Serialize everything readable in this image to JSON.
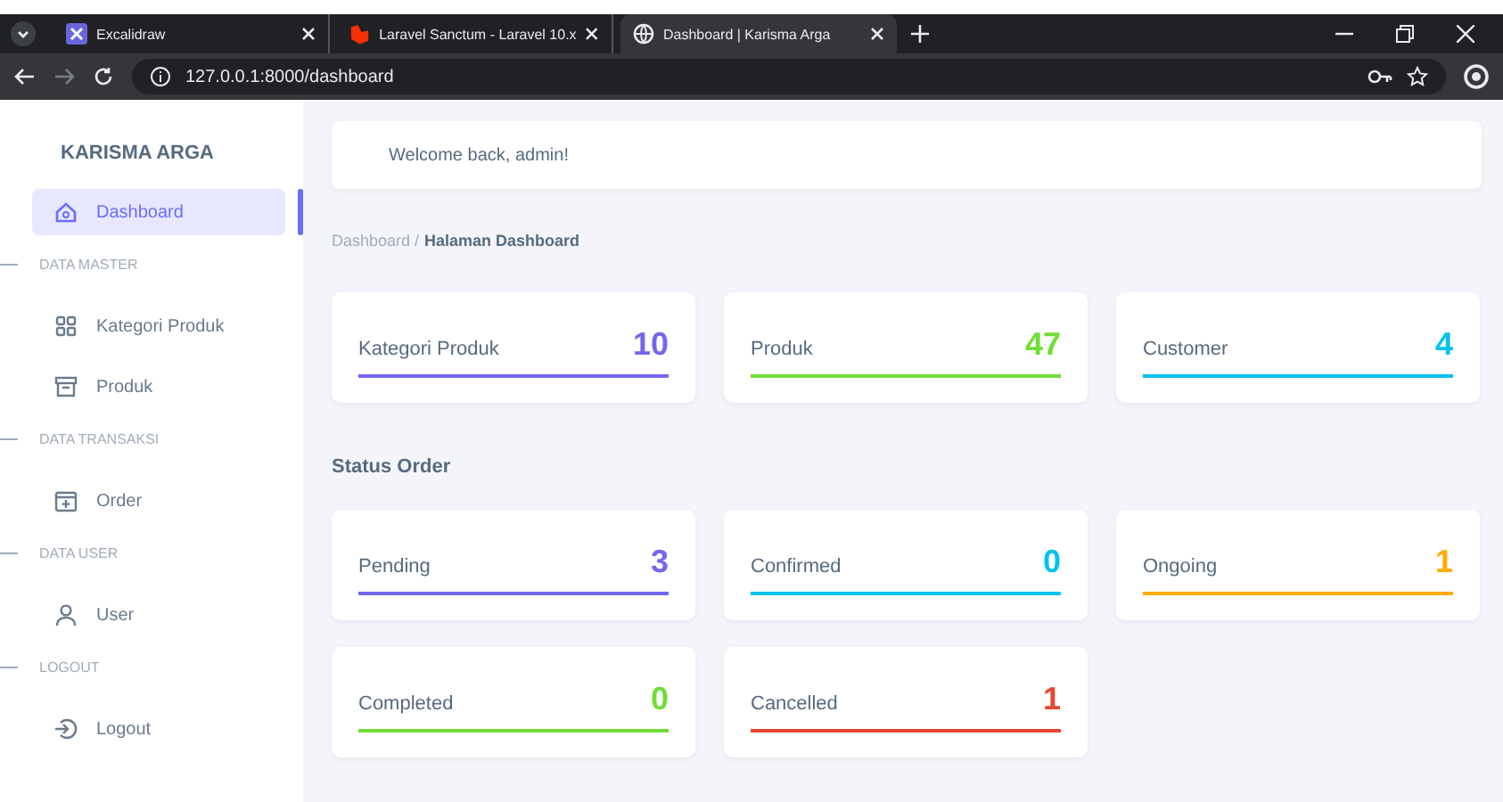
{
  "browser": {
    "tabs": [
      {
        "title": "Excalidraw",
        "selected": false
      },
      {
        "title": "Laravel Sanctum - Laravel 10.x",
        "selected": false
      },
      {
        "title": "Dashboard | Karisma Arga",
        "selected": true
      }
    ],
    "address": "127.0.0.1:8000/dashboard"
  },
  "sidebar": {
    "brand": "KARISMA ARGA",
    "items": [
      {
        "kind": "link",
        "label": "Dashboard",
        "selected": true
      },
      {
        "kind": "section",
        "label": "DATA MASTER"
      },
      {
        "kind": "link",
        "label": "Kategori Produk",
        "selected": false
      },
      {
        "kind": "link",
        "label": "Produk",
        "selected": false
      },
      {
        "kind": "section",
        "label": "DATA TRANSAKSI"
      },
      {
        "kind": "link",
        "label": "Order",
        "selected": false
      },
      {
        "kind": "section",
        "label": "DATA USER"
      },
      {
        "kind": "link",
        "label": "User",
        "selected": false
      },
      {
        "kind": "section",
        "label": "LOGOUT"
      },
      {
        "kind": "link",
        "label": "Logout",
        "selected": false
      }
    ]
  },
  "welcome": "Welcome back, admin!",
  "breadcrumb": {
    "parent": "Dashboard /",
    "current": "Halaman Dashboard"
  },
  "summary_cards": [
    {
      "label": "Kategori Produk",
      "value": "10",
      "color": "#7367f0"
    },
    {
      "label": "Produk",
      "value": "47",
      "color": "#71dd37"
    },
    {
      "label": "Customer",
      "value": "4",
      "color": "#03c3ec"
    }
  ],
  "status_title": "Status Order",
  "status_cards": [
    {
      "label": "Pending",
      "value": "3",
      "color": "#7367f0"
    },
    {
      "label": "Confirmed",
      "value": "0",
      "color": "#03c3ec"
    },
    {
      "label": "Ongoing",
      "value": "1",
      "color": "#ffab00"
    },
    {
      "label": "Completed",
      "value": "0",
      "color": "#71dd37"
    },
    {
      "label": "Cancelled",
      "value": "1",
      "color": "#e8472f"
    }
  ]
}
